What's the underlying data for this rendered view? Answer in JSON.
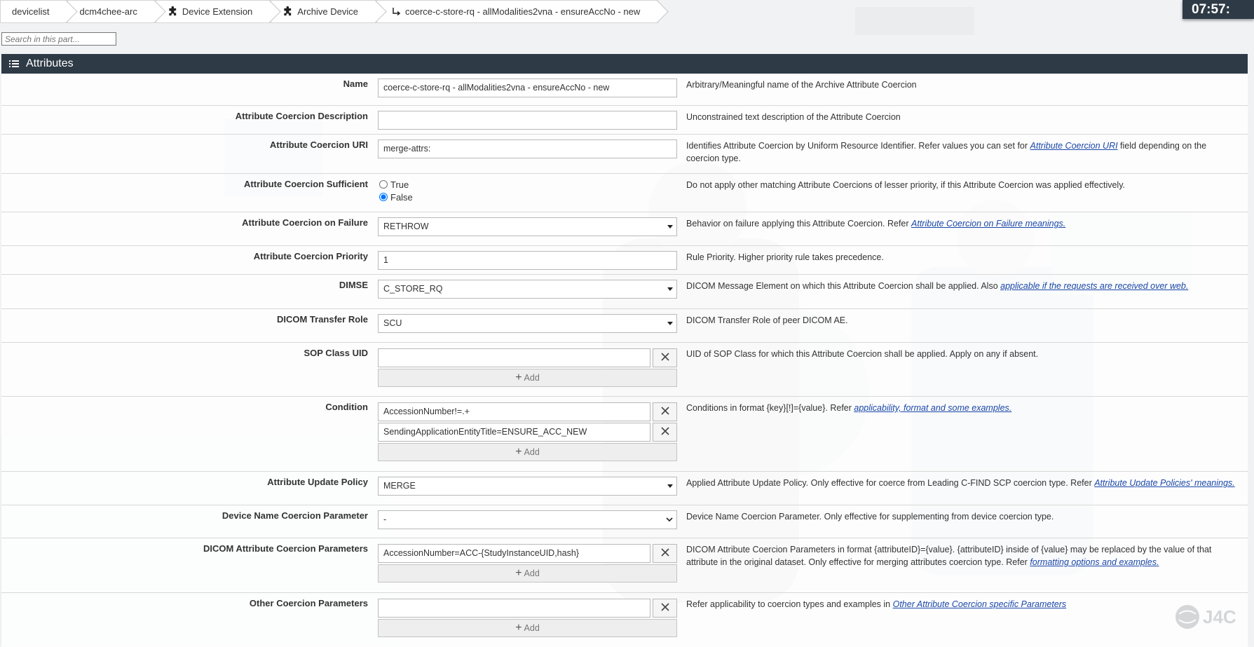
{
  "breadcrumbs": [
    {
      "label": "devicelist",
      "icon": ""
    },
    {
      "label": "dcm4chee-arc",
      "icon": ""
    },
    {
      "label": "Device Extension",
      "icon": "puzzle-icon"
    },
    {
      "label": "Archive Device",
      "icon": "puzzle-icon"
    },
    {
      "label": "coerce-c-store-rq - allModalities2vna - ensureAccNo - new",
      "icon": "return-arrow-icon"
    }
  ],
  "clock": "07:57:",
  "search": {
    "placeholder": "Search in this part..."
  },
  "section": {
    "title": "Attributes",
    "icon": "list-icon",
    "bar_color": "#2e3a45"
  },
  "fields": {
    "name": {
      "label": "Name",
      "value": "coerce-c-store-rq - allModalities2vna - ensureAccNo - new",
      "description": "Arbitrary/Meaningful name of the Archive Attribute Coercion"
    },
    "description": {
      "label": "Attribute Coercion Description",
      "value": "",
      "description": "Unconstrained text description of the Attribute Coercion"
    },
    "uri": {
      "label": "Attribute Coercion URI",
      "value": "merge-attrs:",
      "description_before": "Identifies Attribute Coercion by Uniform Resource Identifier. Refer values you can set for ",
      "link": "Attribute Coercion URI",
      "description_after": " field depending on the coercion type."
    },
    "sufficient": {
      "label": "Attribute Coercion Sufficient",
      "options": [
        "True",
        "False"
      ],
      "selected": "False",
      "description": "Do not apply other matching Attribute Coercions of lesser priority, if this Attribute Coercion was applied effectively."
    },
    "on_failure": {
      "label": "Attribute Coercion on Failure",
      "value": "RETHROW",
      "description_before": "Behavior on failure applying this Attribute Coercion. Refer ",
      "link": "Attribute Coercion on Failure meanings."
    },
    "priority": {
      "label": "Attribute Coercion Priority",
      "value": "1",
      "description": "Rule Priority. Higher priority rule takes precedence."
    },
    "dimse": {
      "label": "DIMSE",
      "value": "C_STORE_RQ",
      "description_before": "DICOM Message Element on which this Attribute Coercion shall be applied. Also ",
      "link": "applicable if the requests are received over web."
    },
    "transfer_role": {
      "label": "DICOM Transfer Role",
      "value": "SCU",
      "description": "DICOM Transfer Role of peer DICOM AE."
    },
    "sop_class": {
      "label": "SOP Class UID",
      "values": [
        ""
      ],
      "add_label": "Add",
      "description": "UID of SOP Class for which this Attribute Coercion shall be applied. Apply on any if absent."
    },
    "condition": {
      "label": "Condition",
      "values": [
        "AccessionNumber!=.+",
        "SendingApplicationEntityTitle=ENSURE_ACC_NEW"
      ],
      "add_label": "Add",
      "description_before": "Conditions in format {key}[!]={value}. Refer ",
      "link": "applicability, format and some examples."
    },
    "update_policy": {
      "label": "Attribute Update Policy",
      "value": "MERGE",
      "description_before": "Applied Attribute Update Policy. Only effective for coerce from Leading C-FIND SCP coercion type. Refer ",
      "link": "Attribute Update Policies' meanings."
    },
    "device_name_param": {
      "label": "Device Name Coercion Parameter",
      "value": "-",
      "description": "Device Name Coercion Parameter. Only effective for supplementing from device coercion type."
    },
    "dicom_params": {
      "label": "DICOM Attribute Coercion Parameters",
      "values": [
        "AccessionNumber=ACC-{StudyInstanceUID,hash}"
      ],
      "add_label": "Add",
      "description_before": "DICOM Attribute Coercion Parameters in format {attributeID}={value}. {attributeID} inside of {value} may be replaced by the value of that attribute in the original dataset. Only effective for merging attributes coercion type. Refer ",
      "link": "formatting options and examples."
    },
    "other_params": {
      "label": "Other Coercion Parameters",
      "values": [
        ""
      ],
      "add_label": "Add",
      "description_before": "Refer applicability to coercion types and examples in ",
      "link": "Other Attribute Coercion specific Parameters"
    }
  },
  "logo": {
    "text": "J4C"
  }
}
